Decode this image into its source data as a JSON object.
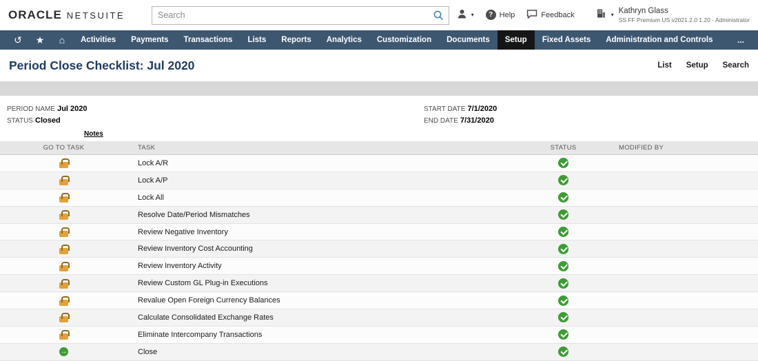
{
  "header": {
    "brand_oracle": "ORACLE",
    "brand_netsuite": "NETSUITE",
    "search_placeholder": "Search",
    "help_label": "Help",
    "feedback_label": "Feedback",
    "user_name": "Kathryn Glass",
    "user_role": "SS FF Premium US v2021.2.0 1.20 - Administrator"
  },
  "nav": {
    "items": [
      "Activities",
      "Payments",
      "Transactions",
      "Lists",
      "Reports",
      "Analytics",
      "Customization",
      "Documents",
      "Setup",
      "Fixed Assets",
      "Administration and Controls"
    ],
    "active": "Setup",
    "overflow": "..."
  },
  "page": {
    "title": "Period Close Checklist: Jul 2020",
    "actions": [
      "List",
      "Setup",
      "Search"
    ]
  },
  "fields": {
    "period_name_label": "PERIOD NAME",
    "period_name_value": "Jul 2020",
    "status_label": "STATUS",
    "status_value": "Closed",
    "start_date_label": "START DATE",
    "start_date_value": "7/1/2020",
    "end_date_label": "END DATE",
    "end_date_value": "7/31/2020",
    "notes_label": "Notes"
  },
  "table": {
    "headers": [
      "GO TO TASK",
      "TASK",
      "STATUS",
      "MODIFIED BY"
    ],
    "rows": [
      {
        "icon": "lock",
        "task": "Lock A/R",
        "status": "complete",
        "modified_by": ""
      },
      {
        "icon": "lock",
        "task": "Lock A/P",
        "status": "complete",
        "modified_by": ""
      },
      {
        "icon": "lock",
        "task": "Lock All",
        "status": "complete",
        "modified_by": ""
      },
      {
        "icon": "lock",
        "task": "Resolve Date/Period Mismatches",
        "status": "complete",
        "modified_by": ""
      },
      {
        "icon": "lock",
        "task": "Review Negative Inventory",
        "status": "complete",
        "modified_by": ""
      },
      {
        "icon": "lock",
        "task": "Review Inventory Cost Accounting",
        "status": "complete",
        "modified_by": ""
      },
      {
        "icon": "lock",
        "task": "Review Inventory Activity",
        "status": "complete",
        "modified_by": ""
      },
      {
        "icon": "lock",
        "task": "Review Custom GL Plug-in Executions",
        "status": "complete",
        "modified_by": ""
      },
      {
        "icon": "lock",
        "task": "Revalue Open Foreign Currency Balances",
        "status": "complete",
        "modified_by": ""
      },
      {
        "icon": "lock",
        "task": "Calculate Consolidated Exchange Rates",
        "status": "complete",
        "modified_by": ""
      },
      {
        "icon": "lock",
        "task": "Eliminate Intercompany Transactions",
        "status": "complete",
        "modified_by": ""
      },
      {
        "icon": "arrow",
        "task": "Close",
        "status": "complete",
        "modified_by": ""
      }
    ]
  },
  "colors": {
    "nav_bg": "#3e5771",
    "nav_active_bg": "#161616",
    "title_color": "#1f3c61",
    "check_green": "#3d9c35",
    "lock_gold": "#e2a23a"
  }
}
